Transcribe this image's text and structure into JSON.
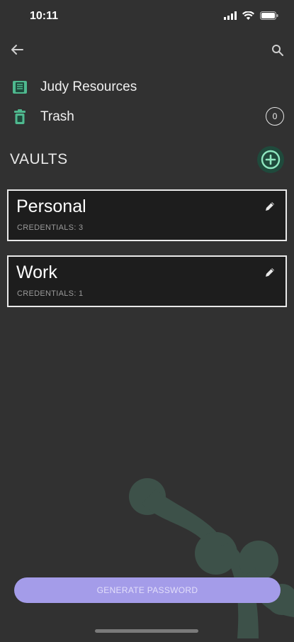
{
  "status_bar": {
    "time": "10:11"
  },
  "nav": {
    "items": [
      {
        "label": "Judy Resources",
        "icon": "book-icon"
      },
      {
        "label": "Trash",
        "icon": "trash-icon",
        "count": "0"
      }
    ]
  },
  "vaults": {
    "title": "VAULTS",
    "list": [
      {
        "name": "Personal",
        "credentials": "CREDENTIALS: 3"
      },
      {
        "name": "Work",
        "credentials": "CREDENTIALS: 1"
      }
    ]
  },
  "footer": {
    "generate_label": "GENERATE PASSWORD"
  },
  "colors": {
    "background": "#313131",
    "accent_green": "#4fb98f",
    "button_purple": "#a49ce9",
    "card_bg": "#1d1d1d"
  }
}
